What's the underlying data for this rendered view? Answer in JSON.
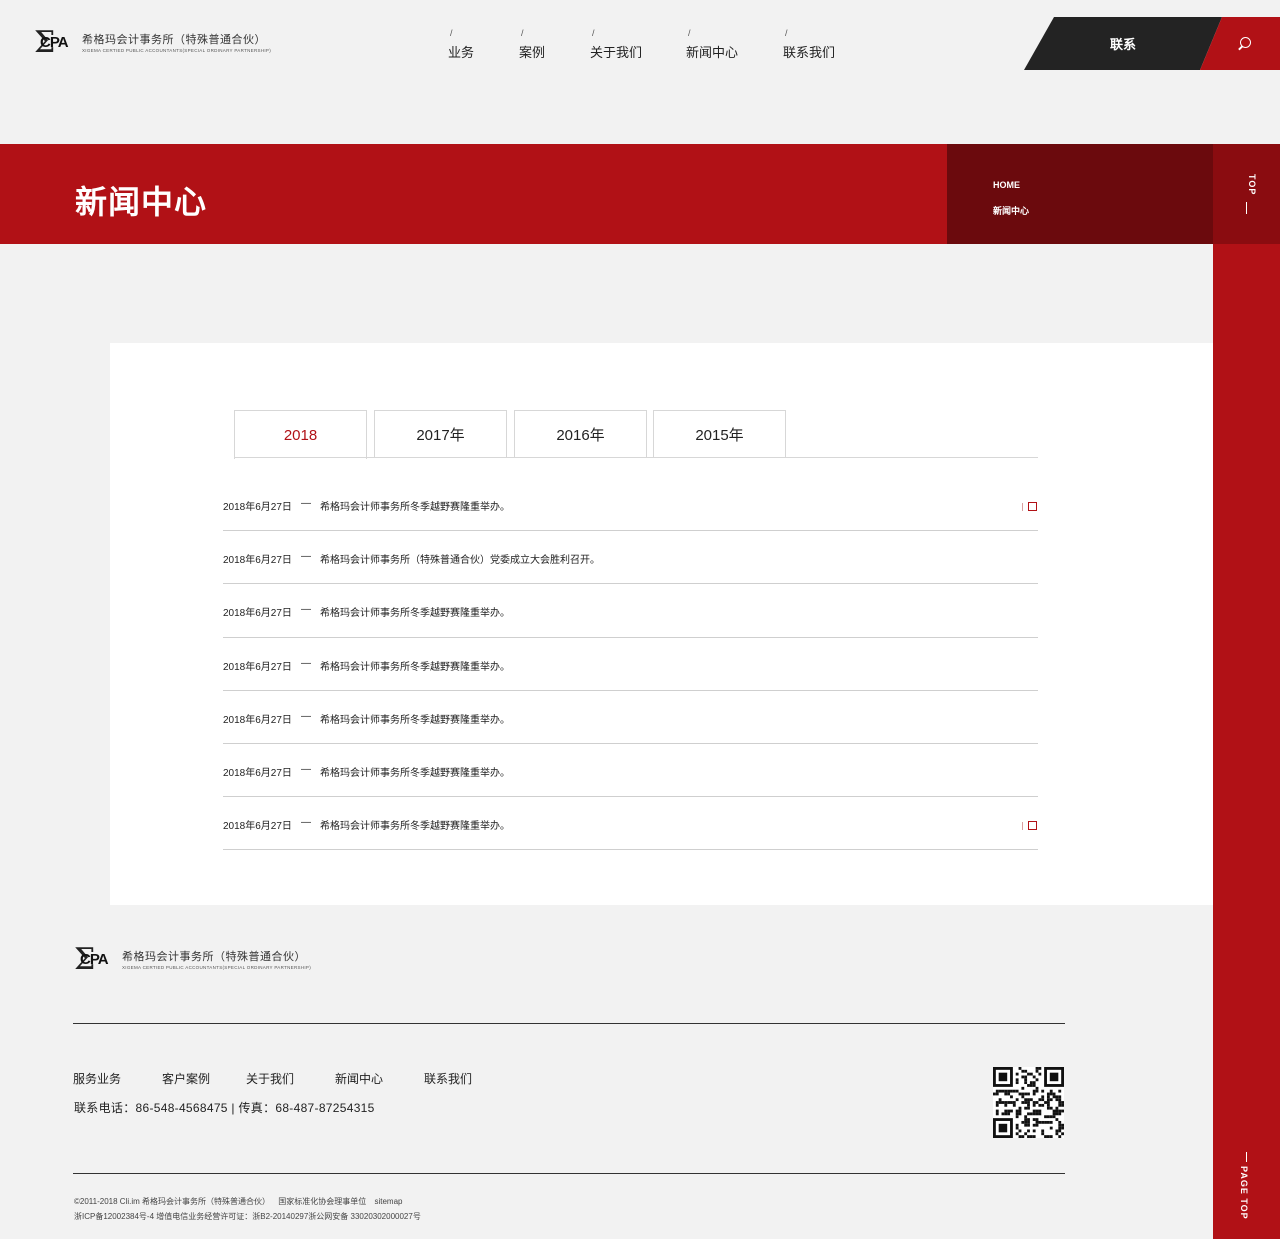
{
  "header": {
    "logo_mark": "CPA",
    "logo_name_cn": "希格玛会计事务所（特殊普通合伙）",
    "logo_name_en": "XIGEMA CERTIED PUBLIC ACCOUNTANTS(SPECIAL ORDINARY PARTNERSHIP)",
    "nav": [
      {
        "label": "业务"
      },
      {
        "label": "案例"
      },
      {
        "label": "关于我们"
      },
      {
        "label": "新闻中心"
      },
      {
        "label": "联系我们"
      }
    ],
    "nav_separator": "/",
    "contact_label": "联系",
    "search_icon": "search-icon"
  },
  "banner": {
    "title": "新闻中心",
    "breadcrumb_home": "HOME",
    "breadcrumb_current": "新闻中心"
  },
  "rail": {
    "top_label": "TOP",
    "page_top_label": "PAGE TOP"
  },
  "tabs": [
    {
      "label": "2018",
      "active": true
    },
    {
      "label": "2017年",
      "active": false
    },
    {
      "label": "2016年",
      "active": false
    },
    {
      "label": "2015年",
      "active": false
    }
  ],
  "news": {
    "dash": "—",
    "items": [
      {
        "date": "2018年6月27日",
        "title": "希格玛会计师事务所冬季越野赛隆重举办。",
        "marked": true
      },
      {
        "date": "2018年6月27日",
        "title": "希格玛会计师事务所（特殊普通合伙）党委成立大会胜利召开。",
        "marked": false
      },
      {
        "date": "2018年6月27日",
        "title": "希格玛会计师事务所冬季越野赛隆重举办。",
        "marked": false
      },
      {
        "date": "2018年6月27日",
        "title": "希格玛会计师事务所冬季越野赛隆重举办。",
        "marked": false
      },
      {
        "date": "2018年6月27日",
        "title": "希格玛会计师事务所冬季越野赛隆重举办。",
        "marked": false
      },
      {
        "date": "2018年6月27日",
        "title": "希格玛会计师事务所冬季越野赛隆重举办。",
        "marked": false
      },
      {
        "date": "2018年6月27日",
        "title": "希格玛会计师事务所冬季越野赛隆重举办。",
        "marked": true
      }
    ]
  },
  "footer": {
    "logo_mark": "CPA",
    "logo_name_cn": "希格玛会计事务所（特殊普通合伙）",
    "logo_name_en": "XIGEMA CERTIED PUBLIC ACCOUNTANTS(SPECIAL ORDINARY PARTNERSHIP)",
    "links": [
      {
        "label": "服务业务"
      },
      {
        "label": "客户案例"
      },
      {
        "label": "关于我们"
      },
      {
        "label": "新闻中心"
      },
      {
        "label": "联系我们"
      }
    ],
    "contact": "联系电话：86-548-4568475 | 传真：68-487-87254315",
    "qr_icon": "qr-code-icon",
    "copyright": "©2011-2018 Cli.im 希格玛会计事务所（特殊普通合伙）",
    "association": "国家标准化协会理事单位",
    "sitemap": "sitemap",
    "icp": "浙ICP备12002384号-4  增值电信业务经营许可证：浙B2-20140297浙公网安备 33020302000027号"
  },
  "colors": {
    "brand_red": "#b11116",
    "dark_red": "#6b0a0d",
    "dark_gray": "#232323",
    "page_bg": "#f2f2f2"
  }
}
